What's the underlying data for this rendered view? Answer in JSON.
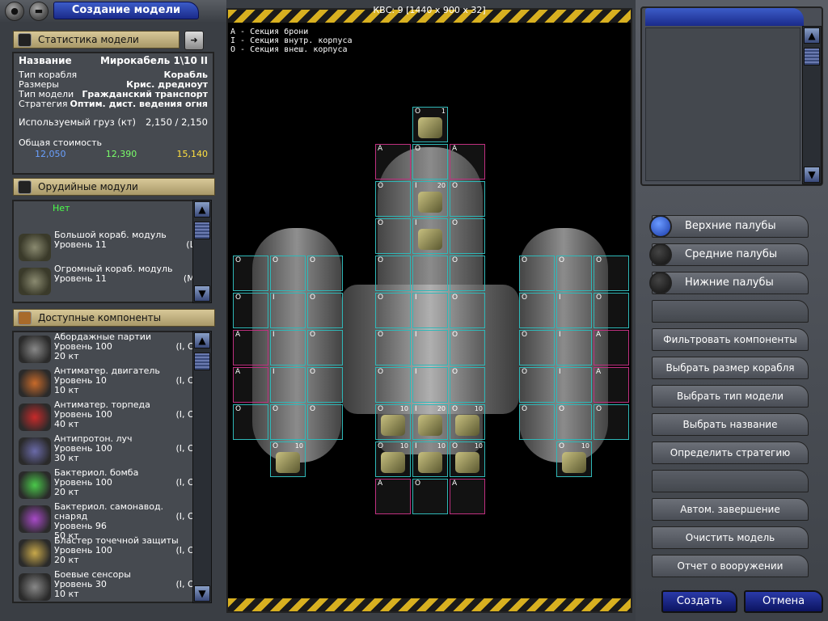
{
  "window_title": "Создание модели",
  "stats": {
    "header": "Статистика модели",
    "name_label": "Название",
    "name_value": "Мирокабель 1\\10 II",
    "rows": [
      {
        "k": "Тип корабля",
        "v": "Корабль"
      },
      {
        "k": "Размеры",
        "v": "Крис. дредноут"
      },
      {
        "k": "Тип модели",
        "v": "Гражданский транспорт"
      },
      {
        "k": "Стратегия",
        "v": "Оптим. дист. ведения огня"
      }
    ],
    "cargo_label": "Используемый груз (кт)",
    "cargo_value": "2,150 / 2,150",
    "cost_label": "Общая стоимость",
    "cost_blue": "12,050",
    "cost_green": "12,390",
    "cost_yellow": "15,140"
  },
  "weapons": {
    "header": "Орудийные модули",
    "none": "Нет",
    "items": [
      {
        "name": "Большой кораб. модуль",
        "level": "Уровень 11",
        "tag": "(L)"
      },
      {
        "name": "Огромный кораб. модуль",
        "level": "Уровень 11",
        "tag": "(M)"
      }
    ]
  },
  "components": {
    "header": "Доступные компоненты",
    "items": [
      {
        "name": "Абордажные партии",
        "level": "Уровень 100",
        "size": "20 кт",
        "tag": "(I, O)"
      },
      {
        "name": "Антиматер. двигатель",
        "level": "Уровень 10",
        "size": "10 кт",
        "tag": "(I, O)"
      },
      {
        "name": "Антиматер. торпеда",
        "level": "Уровень 100",
        "size": "40 кт",
        "tag": "(I, O)"
      },
      {
        "name": "Антипротон. луч",
        "level": "Уровень 100",
        "size": "30 кт",
        "tag": "(I, O)"
      },
      {
        "name": "Бактериол. бомба",
        "level": "Уровень 100",
        "size": "20 кт",
        "tag": "(I, O)"
      },
      {
        "name": "Бактериол. самонавод. снаряд",
        "level": "Уровень 96",
        "size": "50 кт",
        "tag": "(I, O)"
      },
      {
        "name": "Бластер точечной защиты",
        "level": "Уровень 100",
        "size": "20 кт",
        "tag": "(I, O)"
      },
      {
        "name": "Боевые сенсоры",
        "level": "Уровень 30",
        "size": "10 кт",
        "tag": "(I, O)"
      }
    ]
  },
  "viewport": {
    "kvs": "КВС: 9 [1440 x 900 x 32]",
    "legend": [
      "A  - Секция брони",
      "I  - Секция внутр. корпуса",
      "O  - Секция внеш. корпуса"
    ]
  },
  "decks": [
    {
      "label": "Верхние палубы",
      "on": true
    },
    {
      "label": "Средние палубы",
      "on": false
    },
    {
      "label": "Нижние палубы",
      "on": false
    }
  ],
  "actions": [
    "Фильтровать компоненты",
    "Выбрать размер корабля",
    "Выбрать тип модели",
    "Выбрать название",
    "Определить стратегию",
    "",
    "Автом. завершение",
    "Очистить модель",
    "Отчет о вооружении"
  ],
  "create_label": "Создать",
  "cancel_label": "Отмена",
  "colors": {
    "accent": "#1a2a8a",
    "hull": "#2fb8b8",
    "armor": "#c03080"
  }
}
